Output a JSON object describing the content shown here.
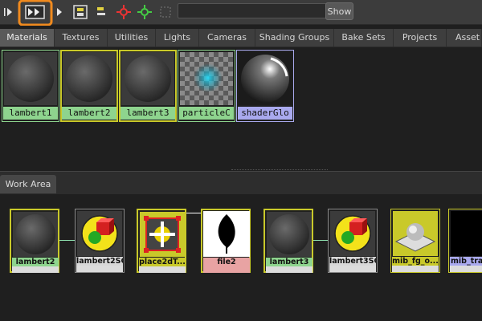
{
  "toolbar": {
    "search_value": "",
    "show_label": "Show",
    "icons": [
      "arrow-right-small-icon",
      "input-output-connections-icon",
      "arrow-right-small-icon",
      "layout-graph-icon",
      "clear-graph-icon",
      "hide-dependents-icon",
      "show-dependents-icon",
      "frame-icon"
    ]
  },
  "tabs": [
    "Materials",
    "Textures",
    "Utilities",
    "Lights",
    "Cameras",
    "Shading Groups",
    "Bake Sets",
    "Projects",
    "Asset No"
  ],
  "swatches": [
    {
      "label": "lambert1",
      "kind": "sphere"
    },
    {
      "label": "lambert2",
      "kind": "sphere"
    },
    {
      "label": "lambert3",
      "kind": "sphere"
    },
    {
      "label": "particleC",
      "kind": "checker"
    },
    {
      "label": "shaderGlo",
      "kind": "glow"
    }
  ],
  "work_area": {
    "tab_label": "Work Area",
    "nodes": [
      {
        "label": "lambert2",
        "kind": "sphere"
      },
      {
        "label": "lambert2SG",
        "kind": "shadinggroup"
      },
      {
        "label": "place2dT...",
        "kind": "place2d"
      },
      {
        "label": "file2",
        "kind": "leaf"
      },
      {
        "label": "lambert3",
        "kind": "sphere"
      },
      {
        "label": "lambert3SG",
        "kind": "shadinggroup"
      },
      {
        "label": "mib_fg_o...",
        "kind": "mib"
      },
      {
        "label": "mib_tran",
        "kind": "dark"
      }
    ]
  },
  "colors": {
    "accent": "#f08a1e",
    "green_label": "#8ed48e",
    "pink_label": "#e8a3a3",
    "violet_label": "#a9a9ee",
    "gold_border": "#c9c92a"
  }
}
